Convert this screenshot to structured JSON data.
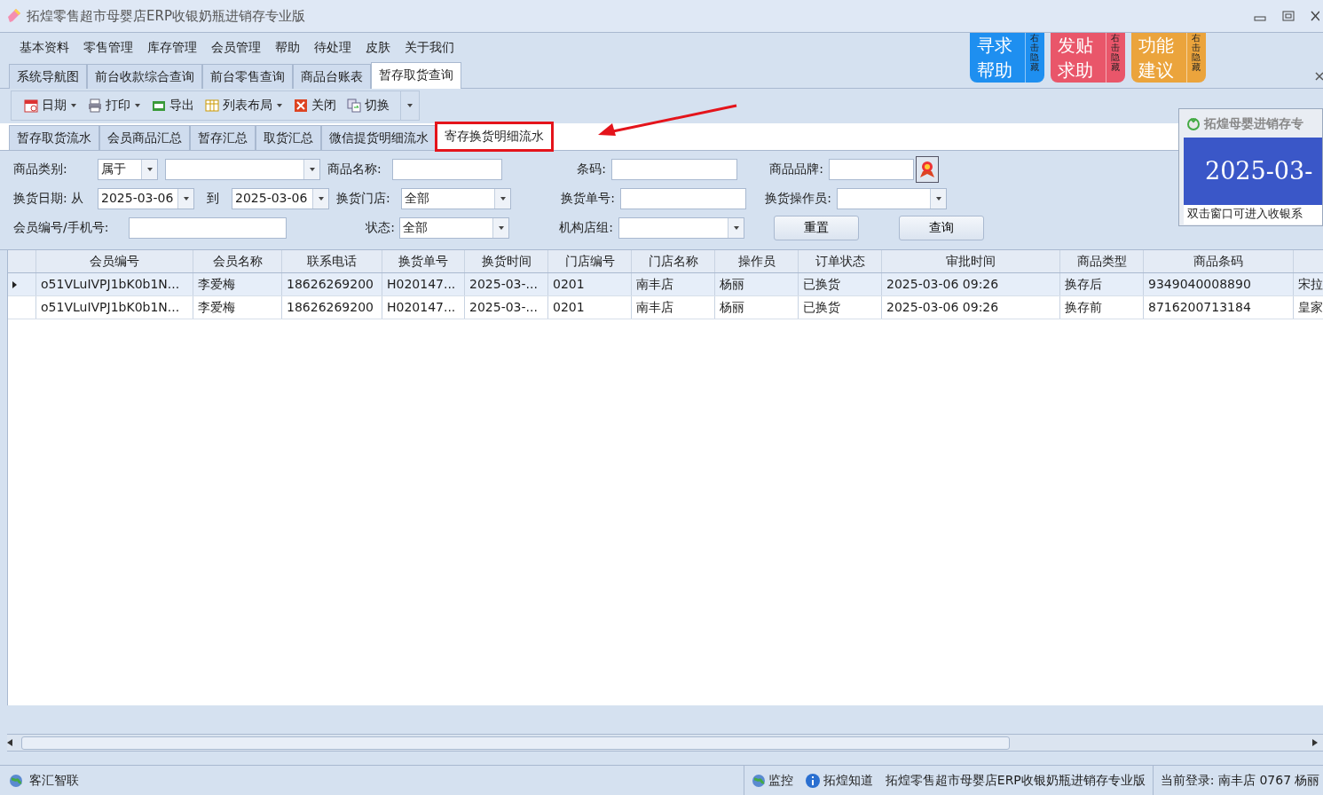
{
  "window": {
    "title": "拓煌零售超市母婴店ERP收银奶瓶进销存专业版"
  },
  "menu": [
    "基本资料",
    "零售管理",
    "库存管理",
    "会员管理",
    "帮助",
    "待处理",
    "皮肤",
    "关于我们"
  ],
  "tabs": [
    {
      "label": "系统导航图",
      "selected": false
    },
    {
      "label": "前台收款综合查询",
      "selected": false
    },
    {
      "label": "前台零售查询",
      "selected": false
    },
    {
      "label": "商品台账表",
      "selected": false
    },
    {
      "label": "暂存取货查询",
      "selected": true
    }
  ],
  "help_buttons": [
    {
      "label": "寻求帮助",
      "side": "右击隐藏",
      "color": "#1e8ff0"
    },
    {
      "label": "发贴求助",
      "side": "右击隐藏",
      "color": "#e9566a"
    },
    {
      "label": "功能建议",
      "side": "右击隐藏",
      "color": "#eba43c"
    }
  ],
  "toolbar": [
    {
      "label": "日期",
      "kind": "calendar",
      "dropdown": true
    },
    {
      "label": "打印",
      "kind": "print",
      "dropdown": true
    },
    {
      "label": "导出",
      "kind": "export",
      "dropdown": false
    },
    {
      "label": "列表布局",
      "kind": "grid",
      "dropdown": true
    },
    {
      "label": "关闭",
      "kind": "close",
      "dropdown": false
    },
    {
      "label": "切换",
      "kind": "switch",
      "dropdown": false
    }
  ],
  "sub_tabs": [
    {
      "label": "暂存取货流水",
      "selected": false,
      "highlighted": false
    },
    {
      "label": "会员商品汇总",
      "selected": false,
      "highlighted": false
    },
    {
      "label": "暂存汇总",
      "selected": false,
      "highlighted": false
    },
    {
      "label": "取货汇总",
      "selected": false,
      "highlighted": false
    },
    {
      "label": "微信提货明细流水",
      "selected": false,
      "highlighted": false
    },
    {
      "label": "寄存换货明细流水",
      "selected": true,
      "highlighted": true
    }
  ],
  "filters": [
    [
      {
        "kind": "label",
        "text": "商品类别:"
      },
      {
        "kind": "select",
        "value": "属于"
      },
      {
        "kind": "select"
      },
      {
        "kind": "label",
        "text": "商品名称:"
      },
      {
        "kind": "text"
      },
      {
        "kind": "label",
        "text": "条码:"
      },
      {
        "kind": "text"
      },
      {
        "kind": "label",
        "text": "商品品牌:"
      },
      {
        "kind": "text"
      },
      {
        "kind": "brand"
      }
    ],
    [
      {
        "kind": "label",
        "text": "换货日期: 从"
      },
      {
        "kind": "select",
        "value": "2025-03-06"
      },
      {
        "kind": "label",
        "text": "到"
      },
      {
        "kind": "select",
        "value": "2025-03-06"
      },
      {
        "kind": "label",
        "text": "换货门店:"
      },
      {
        "kind": "select",
        "value": "全部"
      },
      {
        "kind": "label",
        "text": "换货单号:"
      },
      {
        "kind": "text"
      },
      {
        "kind": "label",
        "text": "换货操作员:"
      },
      {
        "kind": "select"
      }
    ],
    [
      {
        "kind": "label",
        "text": "会员编号/手机号:"
      },
      {
        "kind": "text"
      },
      {
        "kind": "label",
        "text": "状态:"
      },
      {
        "kind": "select",
        "value": "全部"
      },
      {
        "kind": "label",
        "text": "机构店组:"
      },
      {
        "kind": "select"
      },
      {
        "kind": "button",
        "text": "重置"
      },
      {
        "kind": "button",
        "text": "查询"
      }
    ]
  ],
  "table": {
    "columns": [
      "会员编号",
      "会员名称",
      "联系电话",
      "换货单号",
      "换货时间",
      "门店编号",
      "门店名称",
      "操作员",
      "订单状态",
      "审批时间",
      "商品类型",
      "商品条码"
    ],
    "rows": [
      {
        "selected": true,
        "cells": [
          "o51VLuIVPJ1bK0b1N...",
          "李爱梅",
          "18626269200",
          "H020147...",
          "2025-03-...",
          "0201",
          "南丰店",
          "杨丽",
          "已换货",
          "2025-03-06 09:26",
          "换存后",
          "9349040008890",
          "宋拉"
        ]
      },
      {
        "selected": false,
        "cells": [
          "o51VLuIVPJ1bK0b1N...",
          "李爱梅",
          "18626269200",
          "H020147...",
          "2025-03-...",
          "0201",
          "南丰店",
          "杨丽",
          "已换货",
          "2025-03-06 09:26",
          "换存前",
          "8716200713184",
          "皇家"
        ]
      }
    ]
  },
  "popup": {
    "title": "拓煌母婴进销存专",
    "date": "2025-03-",
    "hint": "双击窗口可进入收银系"
  },
  "status_bar": {
    "left": "客汇智联",
    "monitor": "监控",
    "know": "拓煌知道",
    "product": "拓煌零售超市母婴店ERP收银奶瓶进销存专业版",
    "login": "当前登录: 南丰店 0767 杨丽"
  }
}
